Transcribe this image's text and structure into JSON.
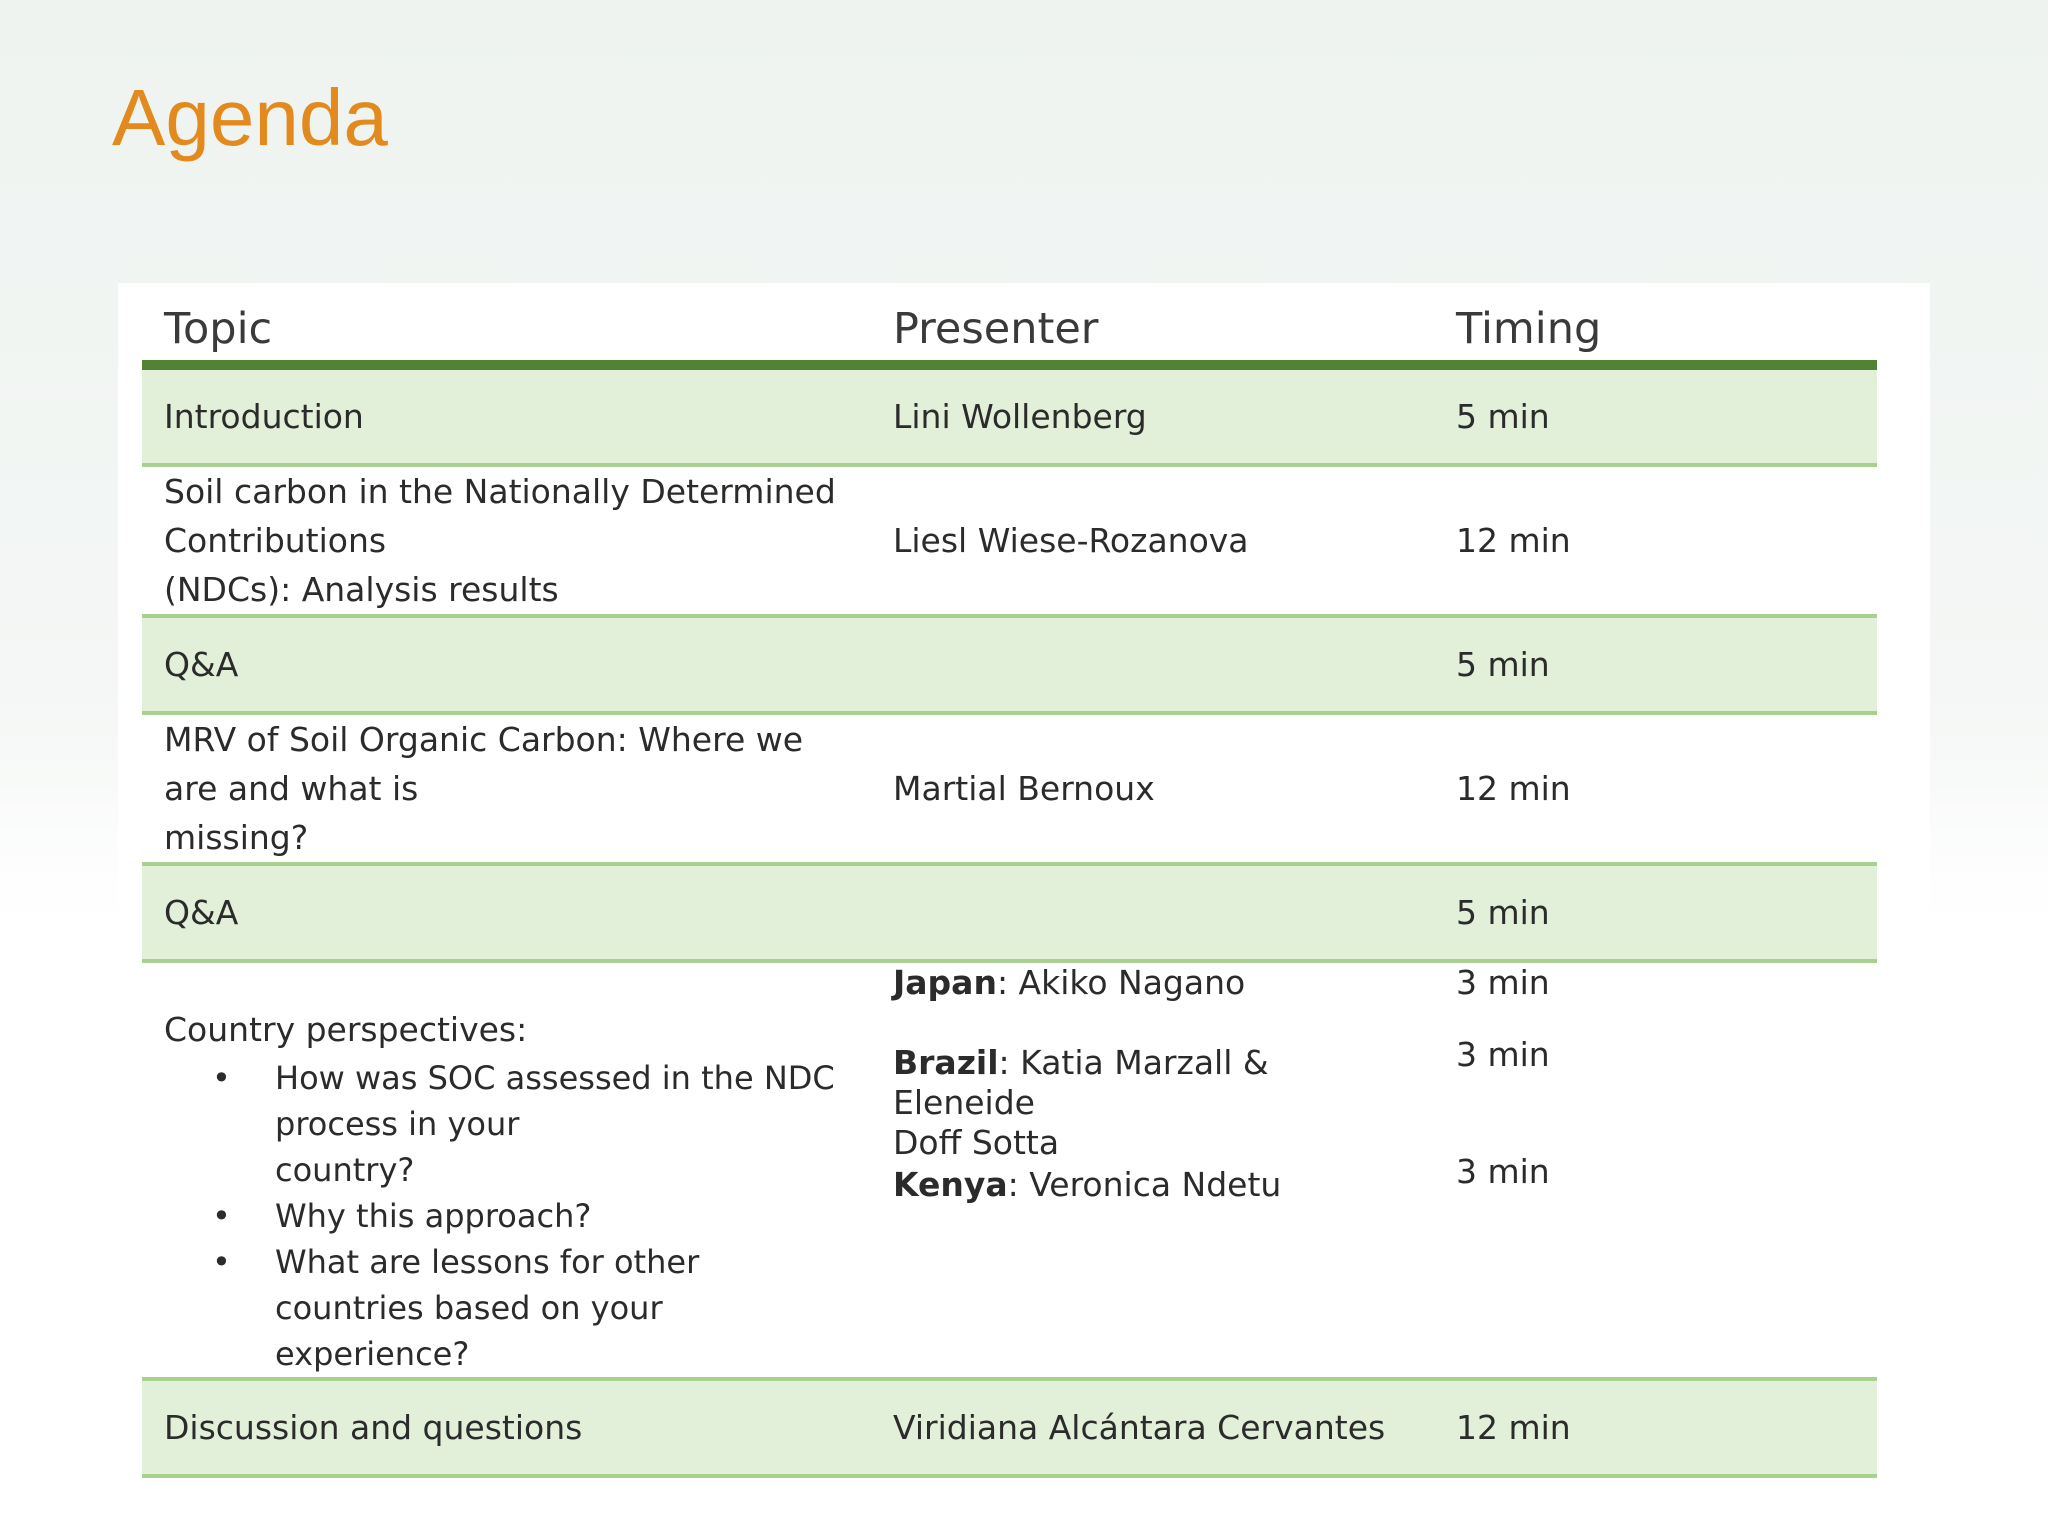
{
  "slide": {
    "title": "Agenda"
  },
  "table": {
    "headers": {
      "topic": "Topic",
      "presenter": "Presenter",
      "timing": "Timing"
    },
    "rows": [
      {
        "topic_line1": "Introduction",
        "topic_line2": "",
        "presenter": "Lini Wollenberg",
        "timing": "5 min"
      },
      {
        "topic_line1": "Soil carbon in the Nationally Determined Contributions",
        "topic_line2": "(NDCs): Analysis results",
        "presenter": "Liesl Wiese-Rozanova",
        "timing": "12 min"
      },
      {
        "topic_line1": "Q&A",
        "topic_line2": "",
        "presenter": "",
        "timing": "5 min"
      },
      {
        "topic_line1": "MRV of Soil Organic Carbon: Where we are and what is",
        "topic_line2": "missing?",
        "presenter": "Martial Bernoux",
        "timing": "12 min"
      },
      {
        "topic_line1": "Q&A",
        "topic_line2": "",
        "presenter": "",
        "timing": "5 min"
      }
    ],
    "country": {
      "intro": "Country perspectives:",
      "bullet_symbol": "•",
      "bullets": [
        {
          "line1": "How was SOC assessed in the NDC process in your",
          "line2": "country?"
        },
        {
          "line1": "Why this approach?",
          "line2": ""
        },
        {
          "line1": "What are lessons for other countries based on your",
          "line2": "experience?"
        }
      ],
      "presenters": [
        {
          "country": "Japan",
          "name": ": Akiko Nagano",
          "name_line2": ""
        },
        {
          "country": "Brazil",
          "name": ": Katia Marzall & Eleneide",
          "name_line2": "Doff Sotta"
        },
        {
          "country": "Kenya",
          "name": ": Veronica Ndetu",
          "name_line2": ""
        }
      ],
      "timings": [
        "3 min",
        "3 min",
        "3 min"
      ]
    },
    "final_row": {
      "topic": "Discussion and questions",
      "presenter": "Viridiana Alcántara Cervantes",
      "timing": "12 min"
    }
  },
  "colors": {
    "title": "#e38a1e",
    "header_rule": "#548235",
    "row_shade": "#e2efd9",
    "row_rule": "#a9d08e"
  }
}
